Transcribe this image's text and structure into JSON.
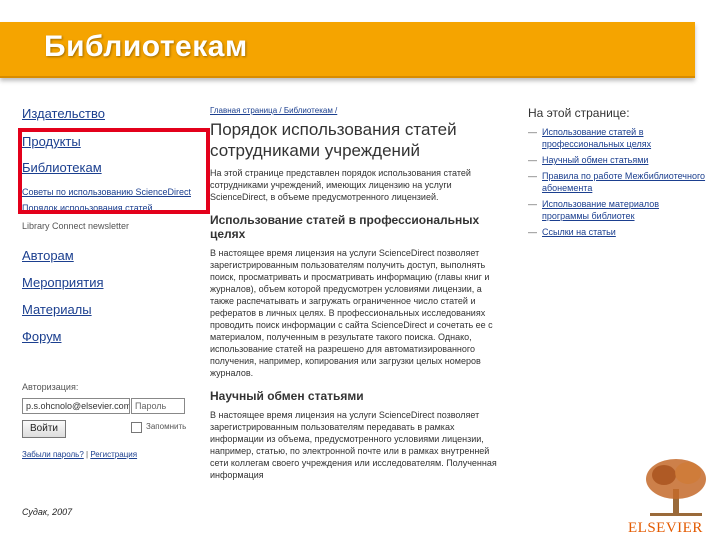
{
  "banner": {
    "title": "Библиотекам"
  },
  "nav": {
    "items": [
      "Издательство",
      "Продукты",
      "Библиотекам"
    ],
    "small_link": "Советы по использованию ScienceDirect",
    "small_link2": "Порядок использования статей",
    "newsletter": "Library Connect newsletter",
    "items2": [
      "Авторам",
      "Мероприятия",
      "Материалы",
      "Форум"
    ]
  },
  "login": {
    "label": "Авторизация:",
    "email_value": "p.s.ohcnolo@elsevier.com",
    "password_placeholder": "Пароль",
    "button": "Войти",
    "remember": "Запомнить",
    "forgot": "Забыли пароль?",
    "register": "Регистрация"
  },
  "main": {
    "breadcrumb": "Главная страница / Библиотекам /",
    "title": "Порядок использования статей сотрудниками учреждений",
    "intro": "На этой странице представлен порядок использования статей сотрудниками учреждений, имеющих лицензию на услуги ScienceDirect, в объеме предусмотренного лицензией.",
    "section1_title": "Использование статей в профессиональных целях",
    "section1_text": "В настоящее время лицензия на услуги ScienceDirect позволяет зарегистрированным пользователям получить доступ, выполнять поиск, просматривать и просматривать информацию (главы книг и журналов), объем которой предусмотрен условиями лицензии, а также распечатывать и загружать ограниченное число статей и рефератов в личных целях. В профессиональных исследованиях проводить поиск информации с сайта ScienceDirect и сочетать ее с материалом, полученным в результате такого поиска. Однако, использование статей на разрешено для автоматизированного получения, например, копирования или загрузки целых номеров журналов.",
    "section2_title": "Научный обмен статьями",
    "section2_text": "В настоящее время лицензия на услуги ScienceDirect позволяет зарегистрированным пользователям передавать в рамках информации из объема, предусмотренного условиями лицензии, например, статью, по электронной почте или в рамках внутренней сети коллегам своего учреждения или исследователям. Полученная информация"
  },
  "right": {
    "title": "На этой странице:",
    "items": [
      "Использование статей в профессиональных целях",
      "Научный обмен статьями",
      "Правила по работе Межбиблиотечного абонемента",
      "Использование материалов программы библиотек",
      "Ссылки на статьи"
    ]
  },
  "footer": {
    "left": "Судак, 2007",
    "brand": "ELSEVIER"
  },
  "colors": {
    "banner": "#f5a400",
    "highlight": "#e3001b",
    "link": "#1b3f8f",
    "brand": "#e35a00"
  }
}
